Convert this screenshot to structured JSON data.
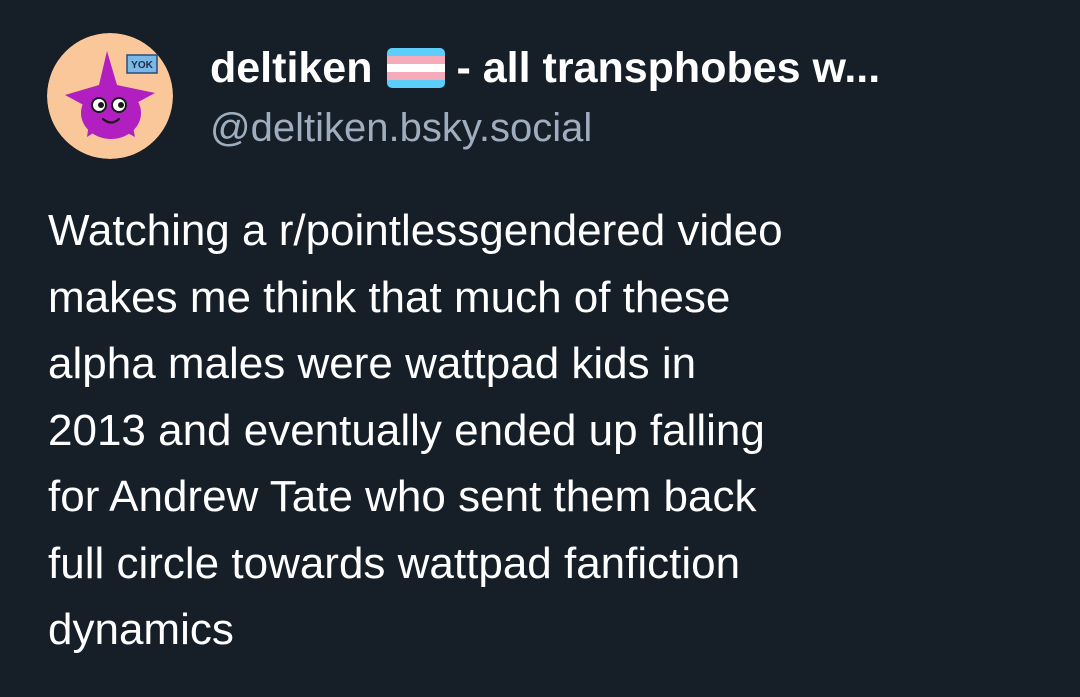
{
  "post": {
    "author": {
      "display_name": "deltiken",
      "name_suffix": "- all transphobes w...",
      "handle": "@deltiken.bsky.social",
      "avatar_badge_text": "YOK",
      "flag": "transgender-flag"
    },
    "body_lines": [
      "Watching a r/pointlessgendered video",
      "makes me think that much of these",
      "alpha males were wattpad kids in",
      "2013 and eventually ended up falling",
      "for Andrew Tate who sent them back",
      "full circle towards wattpad fanfiction",
      "dynamics"
    ]
  },
  "colors": {
    "background": "#161e27",
    "text": "#ffffff",
    "handle": "#9faebf",
    "avatar_bg": "#f9c79a",
    "avatar_character": "#b21fc0",
    "flag_blue": "#5bcffa",
    "flag_pink": "#f5abb9",
    "flag_white": "#ffffff"
  }
}
